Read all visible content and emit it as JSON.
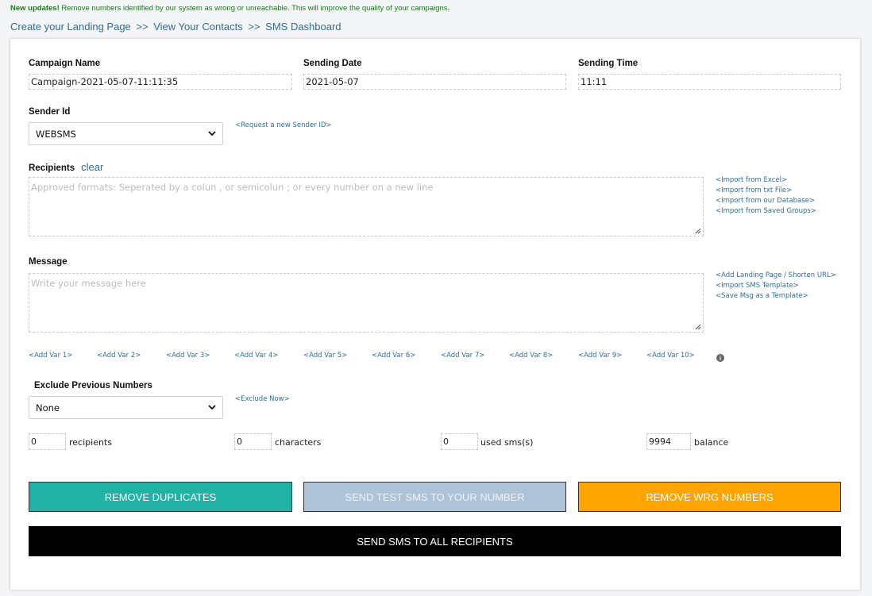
{
  "notice": {
    "bold": "New updates!",
    "text": "Remove numbers identified by our system as wrong or unreachable. This will improve the quality of your campaigns."
  },
  "breadcrumb": {
    "item1": "Create your Landing Page",
    "item2": "View Your Contacts",
    "item3": "SMS Dashboard",
    "sep": ">>"
  },
  "form": {
    "campaign_name_label": "Campaign Name",
    "campaign_name_value": "Campaign-2021-05-07-11:11:35",
    "sending_date_label": "Sending Date",
    "sending_date_value": "2021-05-07",
    "sending_time_label": "Sending Time",
    "sending_time_value": "11:11",
    "sender_id_label": "Sender Id",
    "sender_id_value": "WEBSMS",
    "request_sender_link": "<Request a new Sender ID>",
    "recipients_label": "Recipients",
    "clear_label": "clear",
    "recipients_placeholder": "Approved formats: Seperated by a colun , or semicolun ; or every number on a new line",
    "import_links": [
      "<Import from Excel>",
      "<Import from txt File>",
      "<Import from our Database>",
      "<Import from Saved Groups>"
    ],
    "message_label": "Message",
    "message_placeholder": "Write your message here",
    "message_links": [
      "<Add Landing Page / Shorten URL>",
      "<Import SMS Template>",
      "<Save Msg as a Template>"
    ],
    "vars": [
      "<Add Var 1>",
      "<Add Var 2>",
      "<Add Var 3>",
      "<Add Var 4>",
      "<Add Var 5>",
      "<Add Var 6>",
      "<Add Var 7>",
      "<Add Var 8>",
      "<Add Var 9>",
      "<Add Var 10>"
    ],
    "exclude_label": "Exclude Previous Numbers",
    "exclude_value": "None",
    "exclude_now_link": "<Exclude Now>",
    "counters": {
      "recipients_value": "0",
      "recipients_label": "recipients",
      "characters_value": "0",
      "characters_label": "characters",
      "used_value": "0",
      "used_label": "used sms(s)",
      "balance_value": "9994",
      "balance_label": "balance"
    }
  },
  "buttons": {
    "remove_duplicates": "REMOVE DUPLICATES",
    "send_test": "SEND TEST SMS TO YOUR NUMBER",
    "remove_wrong": "REMOVE WRG NUMBERS",
    "send_all": "SEND SMS TO ALL RECIPIENTS"
  },
  "colors": {
    "teal": "#20b2a5",
    "grey_blue": "#aec3d8",
    "orange": "#ffa500",
    "black": "#000000",
    "link": "#2f6f96",
    "notice_green": "#1e7b1e"
  }
}
